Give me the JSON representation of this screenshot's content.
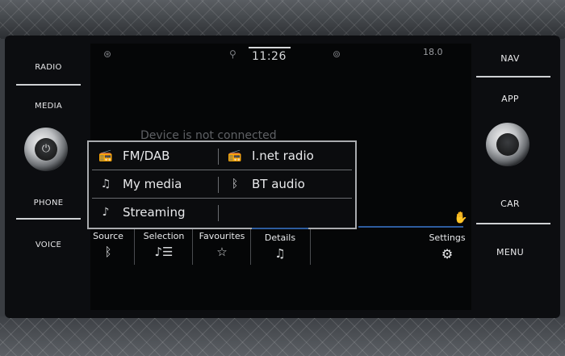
{
  "left_buttons": [
    {
      "label": "RADIO"
    },
    {
      "label": "MEDIA"
    },
    {
      "label": "PHONE"
    },
    {
      "label": "VOICE"
    }
  ],
  "right_buttons": [
    {
      "label": "NAV"
    },
    {
      "label": "APP"
    },
    {
      "label": "CAR"
    },
    {
      "label": "MENU"
    }
  ],
  "status_bar": {
    "time": "11:26",
    "temperature": "18.0"
  },
  "main": {
    "background_message": "Device is not connected"
  },
  "source_menu": {
    "items": [
      {
        "label": "FM/DAB",
        "icon": "radio-icon"
      },
      {
        "label": "I.net radio",
        "icon": "internet-radio-icon"
      },
      {
        "label": "My media",
        "icon": "my-media-icon"
      },
      {
        "label": "BT audio",
        "icon": "bluetooth-icon"
      },
      {
        "label": "Streaming",
        "icon": "streaming-icon"
      }
    ]
  },
  "bottom_tabs": [
    {
      "label": "Source",
      "icon": "bluetooth-icon"
    },
    {
      "label": "Selection",
      "icon": "list-icon"
    },
    {
      "label": "Favourites",
      "icon": "star-icon"
    },
    {
      "label": "Details",
      "icon": "music-note-icon"
    }
  ],
  "settings": {
    "label": "Settings",
    "icon": "gears-icon"
  },
  "colors": {
    "accent": "#2d5c9e",
    "text": "#e9eaec",
    "background": "#050607"
  }
}
